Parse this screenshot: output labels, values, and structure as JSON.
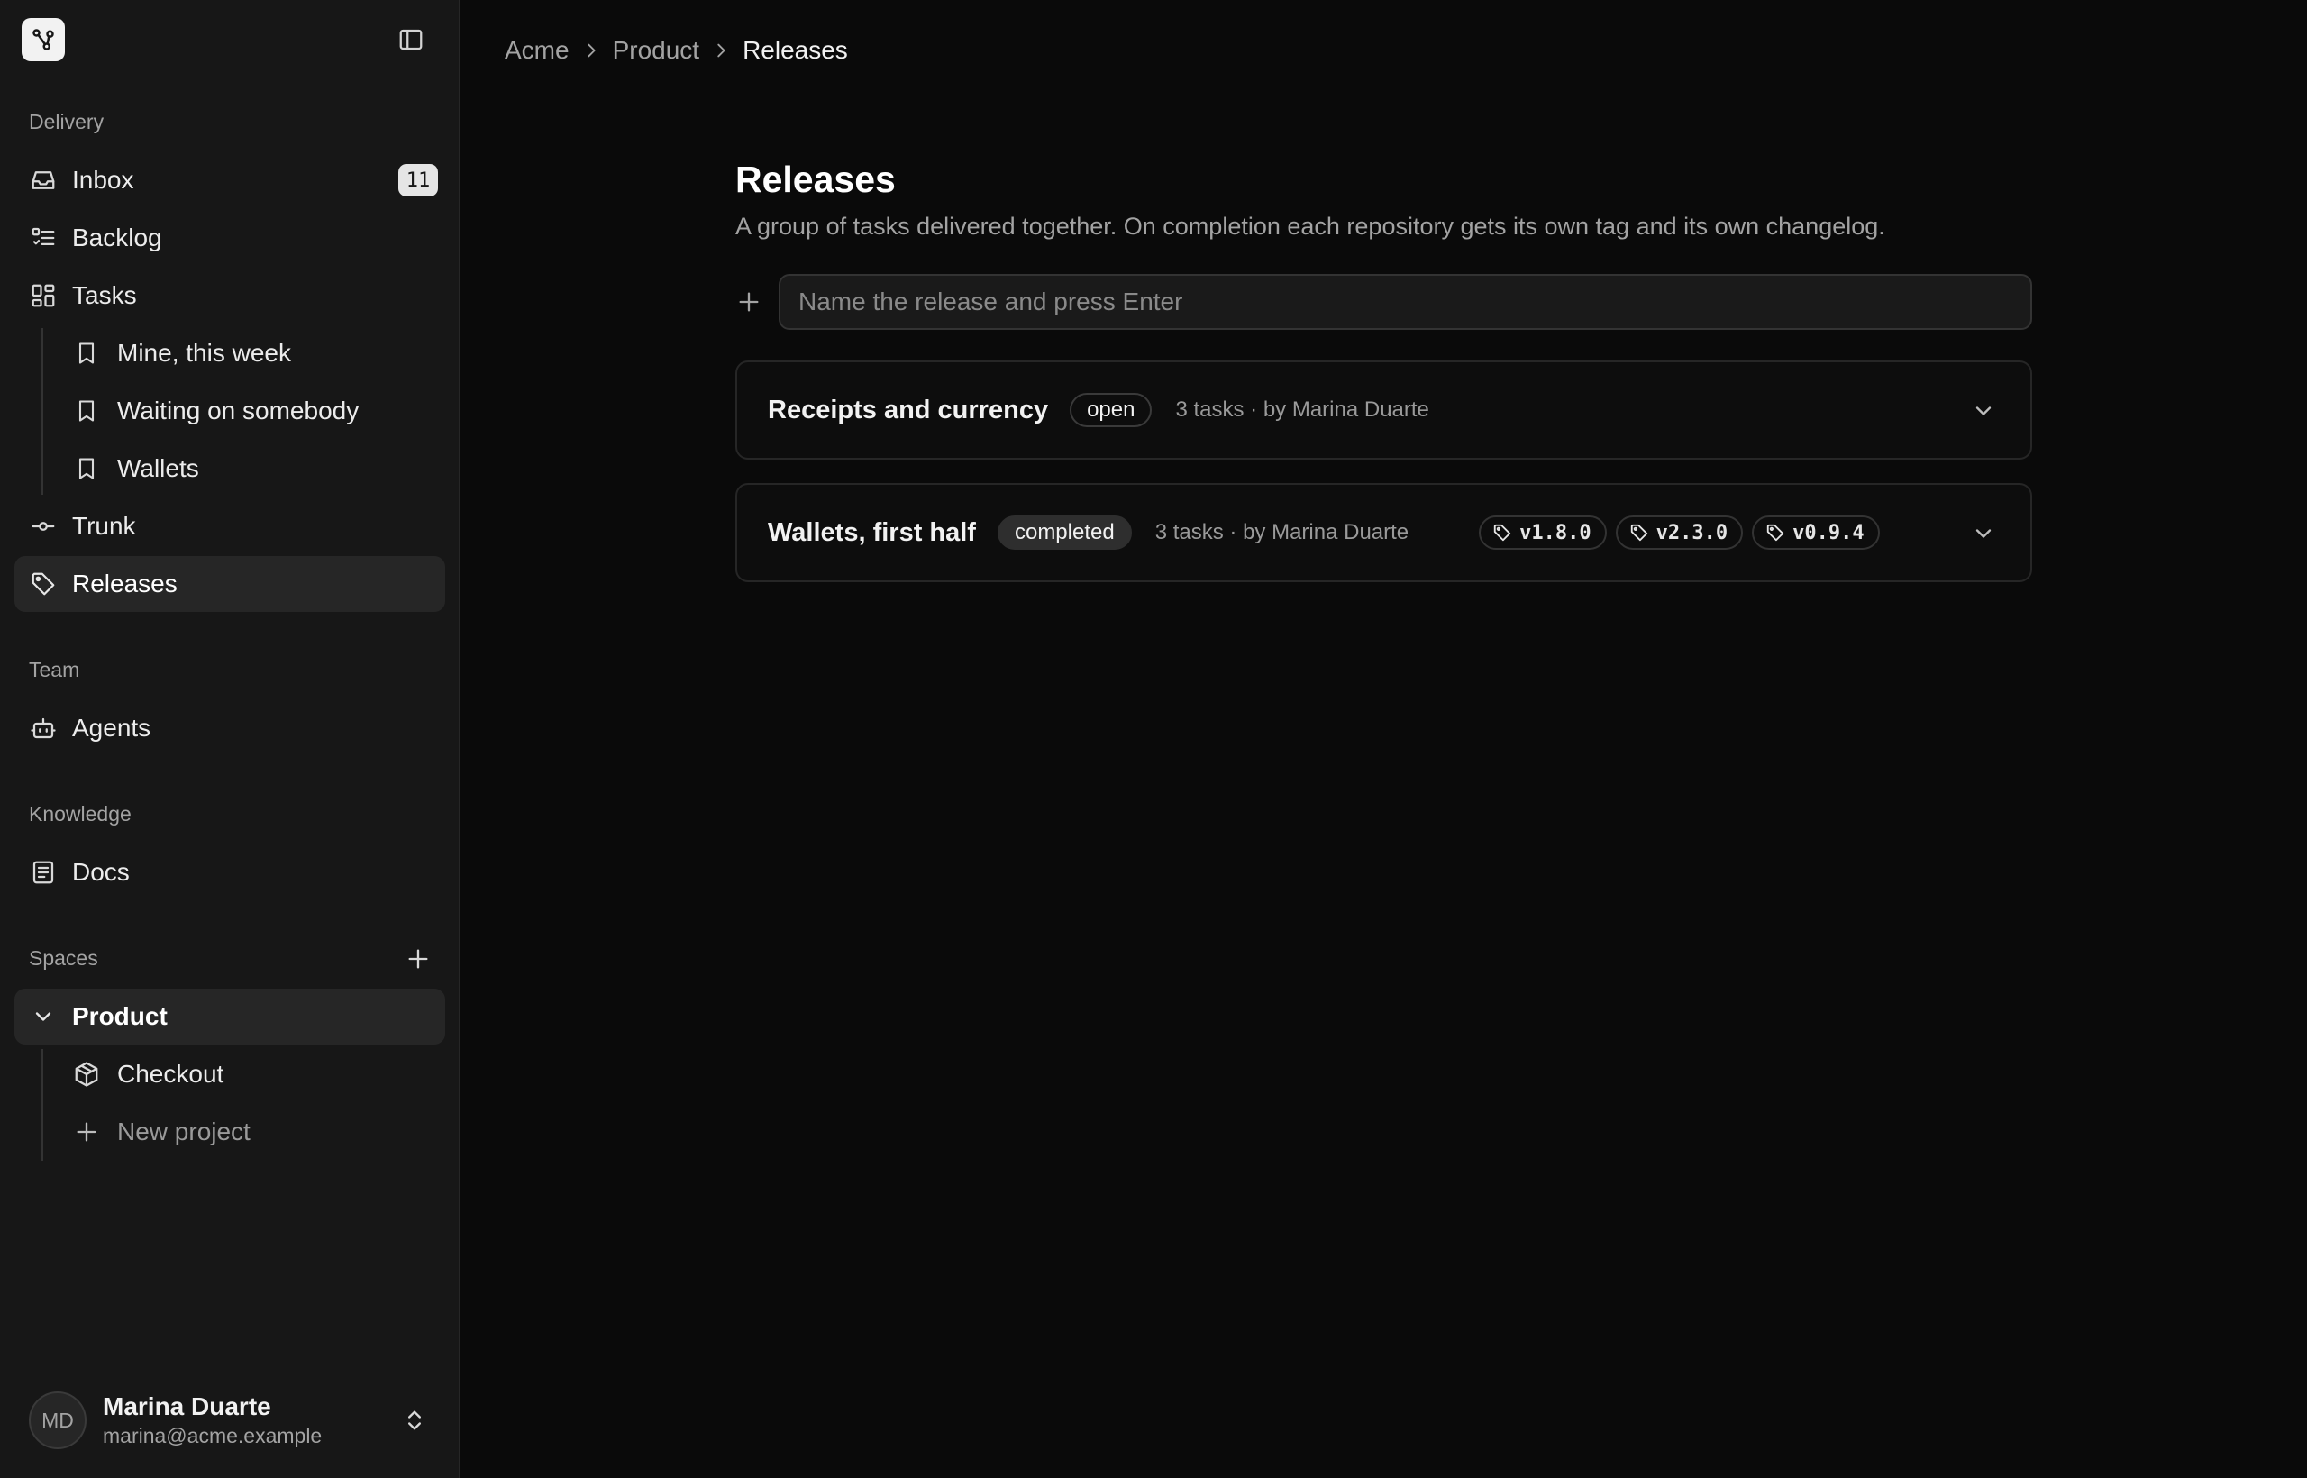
{
  "sidebar": {
    "sections": {
      "delivery": "Delivery",
      "team": "Team",
      "knowledge": "Knowledge",
      "spaces": "Spaces"
    },
    "inbox": {
      "label": "Inbox",
      "count": "11"
    },
    "backlog": {
      "label": "Backlog"
    },
    "tasks": {
      "label": "Tasks"
    },
    "saved_views": [
      {
        "label": "Mine, this week"
      },
      {
        "label": "Waiting on somebody"
      },
      {
        "label": "Wallets"
      }
    ],
    "trunk": {
      "label": "Trunk"
    },
    "releases": {
      "label": "Releases"
    },
    "agents": {
      "label": "Agents"
    },
    "docs": {
      "label": "Docs"
    },
    "space": {
      "label": "Product"
    },
    "projects": [
      {
        "label": "Checkout"
      }
    ],
    "new_project": {
      "label": "New project"
    },
    "user": {
      "initials": "MD",
      "name": "Marina Duarte",
      "email": "marina@acme.example"
    }
  },
  "breadcrumb": [
    "Acme",
    "Product",
    "Releases"
  ],
  "page": {
    "title": "Releases",
    "description": "A group of tasks delivered together. On completion each repository gets its own tag and its own changelog.",
    "input_placeholder": "Name the release and press Enter"
  },
  "releases": [
    {
      "name": "Receipts and currency",
      "status": "open",
      "meta": "3 tasks · by Marina Duarte",
      "tags": []
    },
    {
      "name": "Wallets, first half",
      "status": "completed",
      "meta": "3 tasks · by Marina Duarte",
      "tags": [
        "v1.8.0",
        "v2.3.0",
        "v0.9.4"
      ]
    }
  ],
  "colors": {
    "background": "#0a0a0a",
    "sidebar": "#171717",
    "active_item": "#262626",
    "text_primary": "#f2f2f2",
    "text_muted": "#a3a3a3"
  }
}
